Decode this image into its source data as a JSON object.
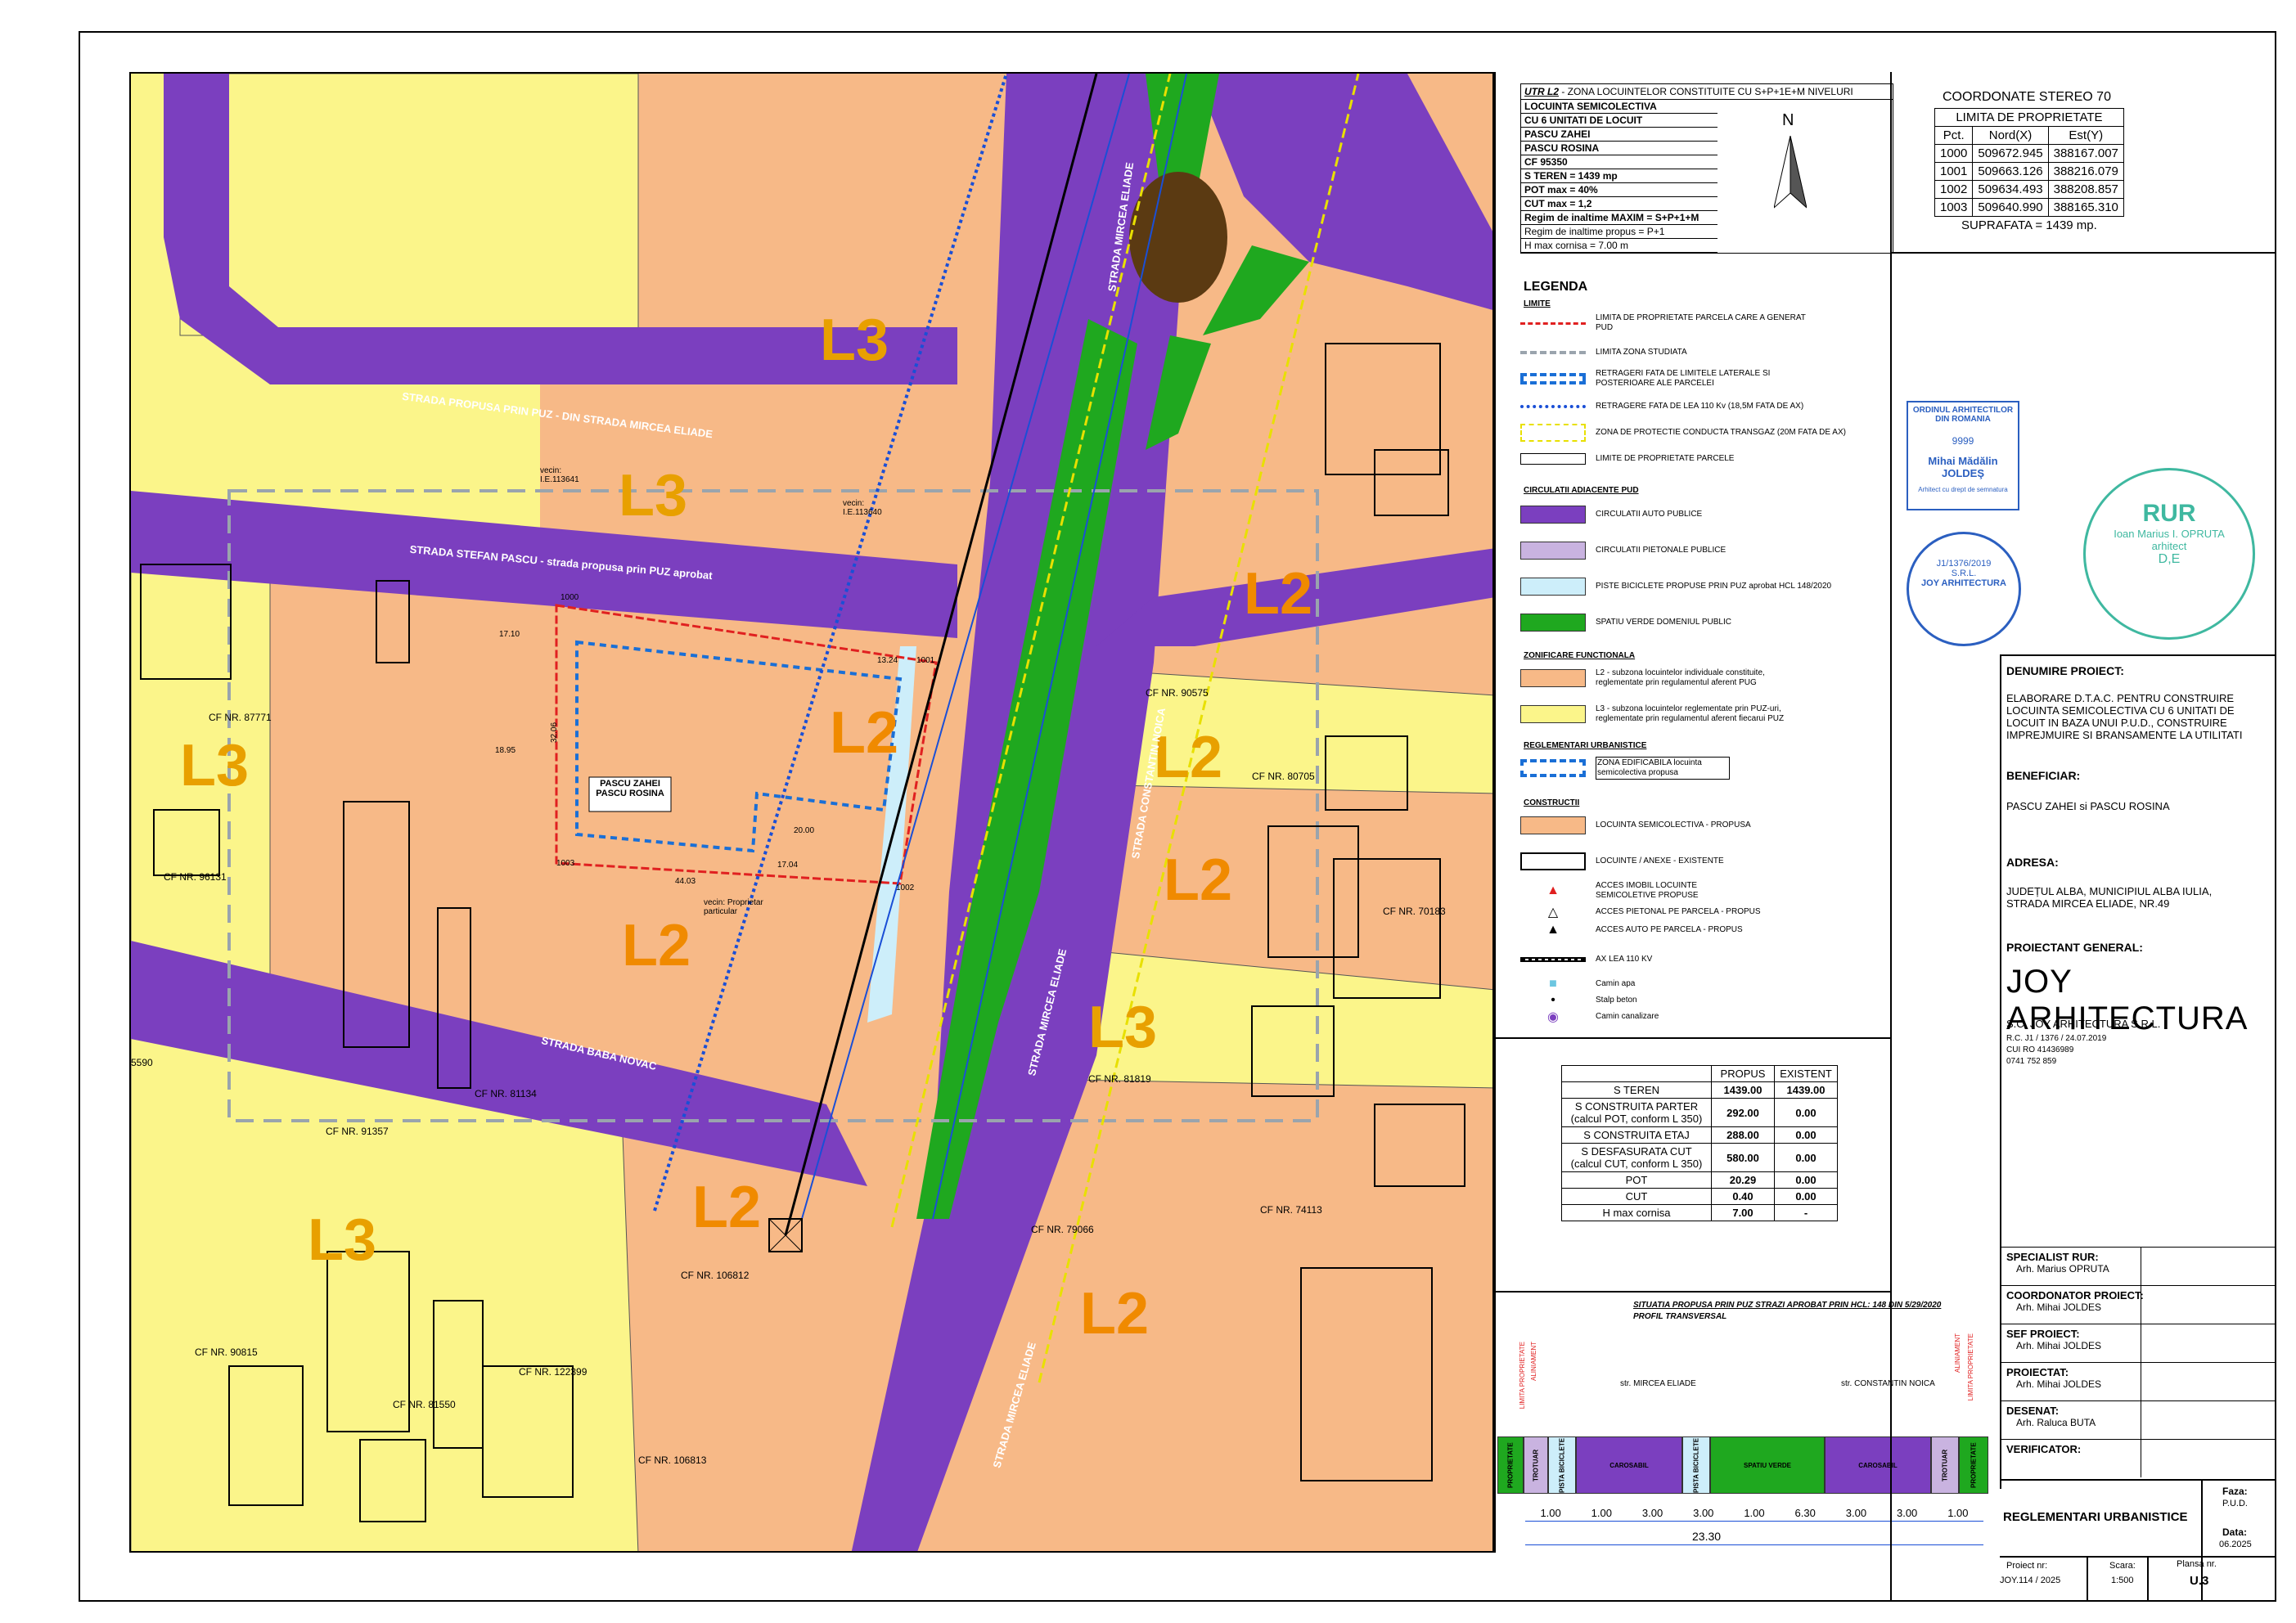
{
  "header": {
    "utr": "UTR L2",
    "utr_rest": " - ZONA LOCUINTELOR CONSTITUITE CU S+P+1E+M NIVELURI",
    "info_lines": [
      "LOCUINTA SEMICOLECTIVA",
      "CU 6 UNITATI DE LOCUIT",
      "PASCU ZAHEI",
      "PASCU ROSINA",
      "CF 95350",
      "S TEREN = 1439 mp",
      "POT max = 40%",
      "CUT max = 1,2",
      "Regim de inaltime MAXIM = S+P+1+M",
      "Regim de inaltime propus = P+1",
      "H max cornisa = 7.00 m"
    ]
  },
  "north": "N",
  "coords": {
    "title": "COORDONATE STEREO 70",
    "subtitle": "LIMITA DE PROPRIETATE",
    "headers": [
      "Pct.",
      "Nord(X)",
      "Est(Y)"
    ],
    "rows": [
      [
        "1000",
        "509672.945",
        "388167.007"
      ],
      [
        "1001",
        "509663.126",
        "388216.079"
      ],
      [
        "1002",
        "509634.493",
        "388208.857"
      ],
      [
        "1003",
        "509640.990",
        "388165.310"
      ]
    ],
    "footer": "SUPRAFATA = 1439 mp."
  },
  "legend": {
    "title": "LEGENDA",
    "sections": {
      "limite": "LIMITE",
      "circulatii": "CIRCULATII ADIACENTE PUD",
      "zonificare": "ZONIFICARE FUNCTIONALA",
      "reglementari": "REGLEMENTARI URBANISTICE",
      "constructii": "CONSTRUCTII"
    },
    "items": {
      "limita_prop": "LIMITA DE PROPRIETATE PARCELA CARE A GENERAT PUD",
      "limita_zona": "LIMITA ZONA STUDIATA",
      "retrageri": "RETRAGERI FATA DE LIMITELE LATERALE SI POSTERIOARE ALE PARCELEI",
      "retragere_lea": "RETRAGERE FATA DE LEA 110 Kv (18,5M FATA DE AX)",
      "protectie": "ZONA DE PROTECTIE CONDUCTA TRANSGAZ (20M FATA DE AX)",
      "limite_parcele": "LIMITE DE PROPRIETATE PARCELE",
      "auto": "CIRCULATII AUTO PUBLICE",
      "pietonale": "CIRCULATII PIETONALE PUBLICE",
      "piste": "PISTE BICICLETE PROPUSE PRIN PUZ aprobat HCL 148/2020",
      "verde": "SPATIU VERDE DOMENIUL PUBLIC",
      "l2": "L2 - subzona locuintelor individuale constituite, reglementate prin regulamentul aferent PUG",
      "l3": "L3 - subzona locuintelor reglementate prin PUZ-uri, reglementate prin regulamentul aferent fiecarui PUZ",
      "edificabila": "ZONA EDIFICABILA locuinta semicolectiva propusa",
      "propusa": "LOCUINTA SEMICOLECTIVA - PROPUSA",
      "existente": "LOCUINTE / ANEXE - EXISTENTE",
      "acces_imobil": "ACCES IMOBIL LOCUINTE SEMICOLETIVE PROPUSE",
      "acces_pietonal": "ACCES PIETONAL PE PARCELA - PROPUS",
      "acces_auto": "ACCES AUTO PE PARCELA - PROPUS",
      "ax_lea": "AX LEA 110 KV",
      "camin_apa": "Camin apa",
      "stalp": "Stalp beton",
      "camin_canal": "Camin canalizare"
    },
    "colors": {
      "auto": "#7b3fbf",
      "pietonal": "#c9b3e0",
      "piste": "#cdeefa",
      "verde": "#1fa81f",
      "l2": "#f7b987",
      "l3": "#fbf58a",
      "red": "#e02020",
      "blue": "#1a4fd6"
    }
  },
  "stats": {
    "headers": [
      "",
      "PROPUS",
      "EXISTENT"
    ],
    "rows": [
      [
        "S TEREN",
        "1439.00",
        "1439.00"
      ],
      [
        "S CONSTRUITA PARTER (calcul POT, conform L 350)",
        "292.00",
        "0.00"
      ],
      [
        "S CONSTRUITA ETAJ",
        "288.00",
        "0.00"
      ],
      [
        "S DESFASURATA CUT (calcul CUT, conform L 350)",
        "580.00",
        "0.00"
      ],
      [
        "POT",
        "20.29",
        "0.00"
      ],
      [
        "CUT",
        "0.40",
        "0.00"
      ],
      [
        "H max cornisa",
        "7.00",
        "-"
      ]
    ]
  },
  "profile": {
    "title": "SITUATIA PROPUSA PRIN PUZ STRAZI APROBAT PRIN HCL: 148 DIN 5/29/2020",
    "subtitle": "PROFIL TRANSVERSAL",
    "street_left": "str. MIRCEA ELIADE",
    "street_right": "str. CONSTANTIN NOICA",
    "bands": [
      "PROPRIETATE",
      "TROTUAR",
      "PISTA BICICLETE",
      "CAROSABIL",
      "PISTA BICICLETE",
      "SPATIU VERDE",
      "CAROSABIL",
      "TROTUAR",
      "PROPRIETATE"
    ],
    "limit_labels": [
      "LIMITA PROPRIETATE",
      "ALINIAMENT",
      "ALINIAMENT",
      "LIMITA PROPRIETATE"
    ],
    "dims": [
      "1.00",
      "1.00",
      "3.00",
      "3.00",
      "1.00",
      "6.30",
      "3.00",
      "3.00",
      "1.00"
    ],
    "total": "23.30"
  },
  "stamps": {
    "oar_top": "ORDINUL ARHITECTILOR DIN ROMANIA",
    "oar_num": "9999",
    "oar_name": "Mihai Mădălin JOLDEŞ",
    "oar_note": "Arhitect cu drept de semnatura",
    "rur_label": "RUR",
    "rur_name": "Ioan Marius I. OPRUTA",
    "rur_role": "arhitect",
    "rur_grade": "D,E",
    "joy_stamp_name": "JOY ARHITECTURA",
    "joy_stamp_reg": "J1/1376/2019",
    "joy_stamp_srl": "S.R.L."
  },
  "project": {
    "name_label": "DENUMIRE PROIECT:",
    "name": "ELABORARE D.T.A.C. PENTRU CONSTRUIRE LOCUINTA SEMICOLECTIVA CU 6 UNITATI DE LOCUIT IN BAZA UNUI P.U.D., CONSTRUIRE IMPREJMUIRE SI BRANSAMENTE LA UTILITATI",
    "beneficiar_label": "BENEFICIAR:",
    "beneficiar": "PASCU ZAHEI si  PASCU ROSINA",
    "adresa_label": "ADRESA:",
    "adresa": "JUDEȚUL ALBA, MUNICIPIUL ALBA IULIA, STRADA MIRCEA ELIADE, NR.49",
    "general_label": "PROIECTANT GENERAL:",
    "logo": "JOY ARHITECTURA",
    "company": "S.C. JOY ARHITECTURA S.R.L.",
    "rc": "R.C.  J1 / 1376 / 24.07.2019",
    "cui": "CUI RO 41436989",
    "phone": "0741 752 859"
  },
  "signatures": [
    {
      "label": "SPECIALIST RUR:",
      "name": "Arh. Marius OPRUTA"
    },
    {
      "label": "COORDONATOR PROIECT:",
      "name": "Arh. Mihai JOLDES"
    },
    {
      "label": "SEF PROIECT:",
      "name": "Arh. Mihai JOLDES"
    },
    {
      "label": "PROIECTAT:",
      "name": "Arh. Mihai JOLDES"
    },
    {
      "label": "DESENAT:",
      "name": "Arh. Raluca  BUTA"
    },
    {
      "label": "VERIFICATOR:",
      "name": ""
    }
  ],
  "plan": {
    "title": "REGLEMENTARI URBANISTICE",
    "faza_label": "Faza:",
    "faza": "P.U.D.",
    "data_label": "Data:",
    "data": "06.2025",
    "proiect_label": "Proiect  nr:",
    "proiect": "JOY.114 / 2025",
    "scara_label": "Scara:",
    "scara": "1:500",
    "plansa_label": "Plansa nr.",
    "plansa": "U.3"
  },
  "map": {
    "zones": [
      "L3",
      "L3",
      "L2",
      "L2",
      "L3",
      "L2",
      "L2",
      "L3",
      "L2",
      "L3",
      "L2",
      "L3"
    ],
    "streets": [
      "STRADA PROPUSA PRIN PUZ - DIN STRADA MIRCEA ELIADE",
      "STRADA STEFAN PASCU - strada propusa prin PUZ aprobat",
      "STRADA BABA NOVAC",
      "STRADA MIRCEA ELIADE",
      "STRADA CONSTANTIN NOICA",
      "STRADA MIRCEA ELIADE",
      "STRADA MIRCEA ELIADE"
    ],
    "cf": [
      "CF NR. 87771",
      "CF NR. 96131",
      "CF NR. 90575",
      "CF NR. 80705",
      "CF NR. 70183",
      "CF NR. 81819",
      "CF NR. 81134",
      "CF NR. 91357",
      "CF NR. 79066",
      "CF NR. 74113",
      "CF NR. 106812",
      "CF NR. 90815",
      "CF NR. 122399",
      "CF NR. 81550",
      "CF NR. 106813",
      "5590"
    ],
    "neighbors": [
      "vecin: I.E.113641",
      "vecin: I.E.113640",
      "vecin: Proprietar particular",
      "vecin: Proprietar particular"
    ],
    "owner_label": "PASCU ZAHEI PASCU ROSINA",
    "points": [
      "1000",
      "1001",
      "1002",
      "1003"
    ],
    "dims": [
      "17.10",
      "18.95",
      "32.06",
      "44.03",
      "17.04",
      "20.00",
      "13.24",
      "2.00"
    ]
  }
}
